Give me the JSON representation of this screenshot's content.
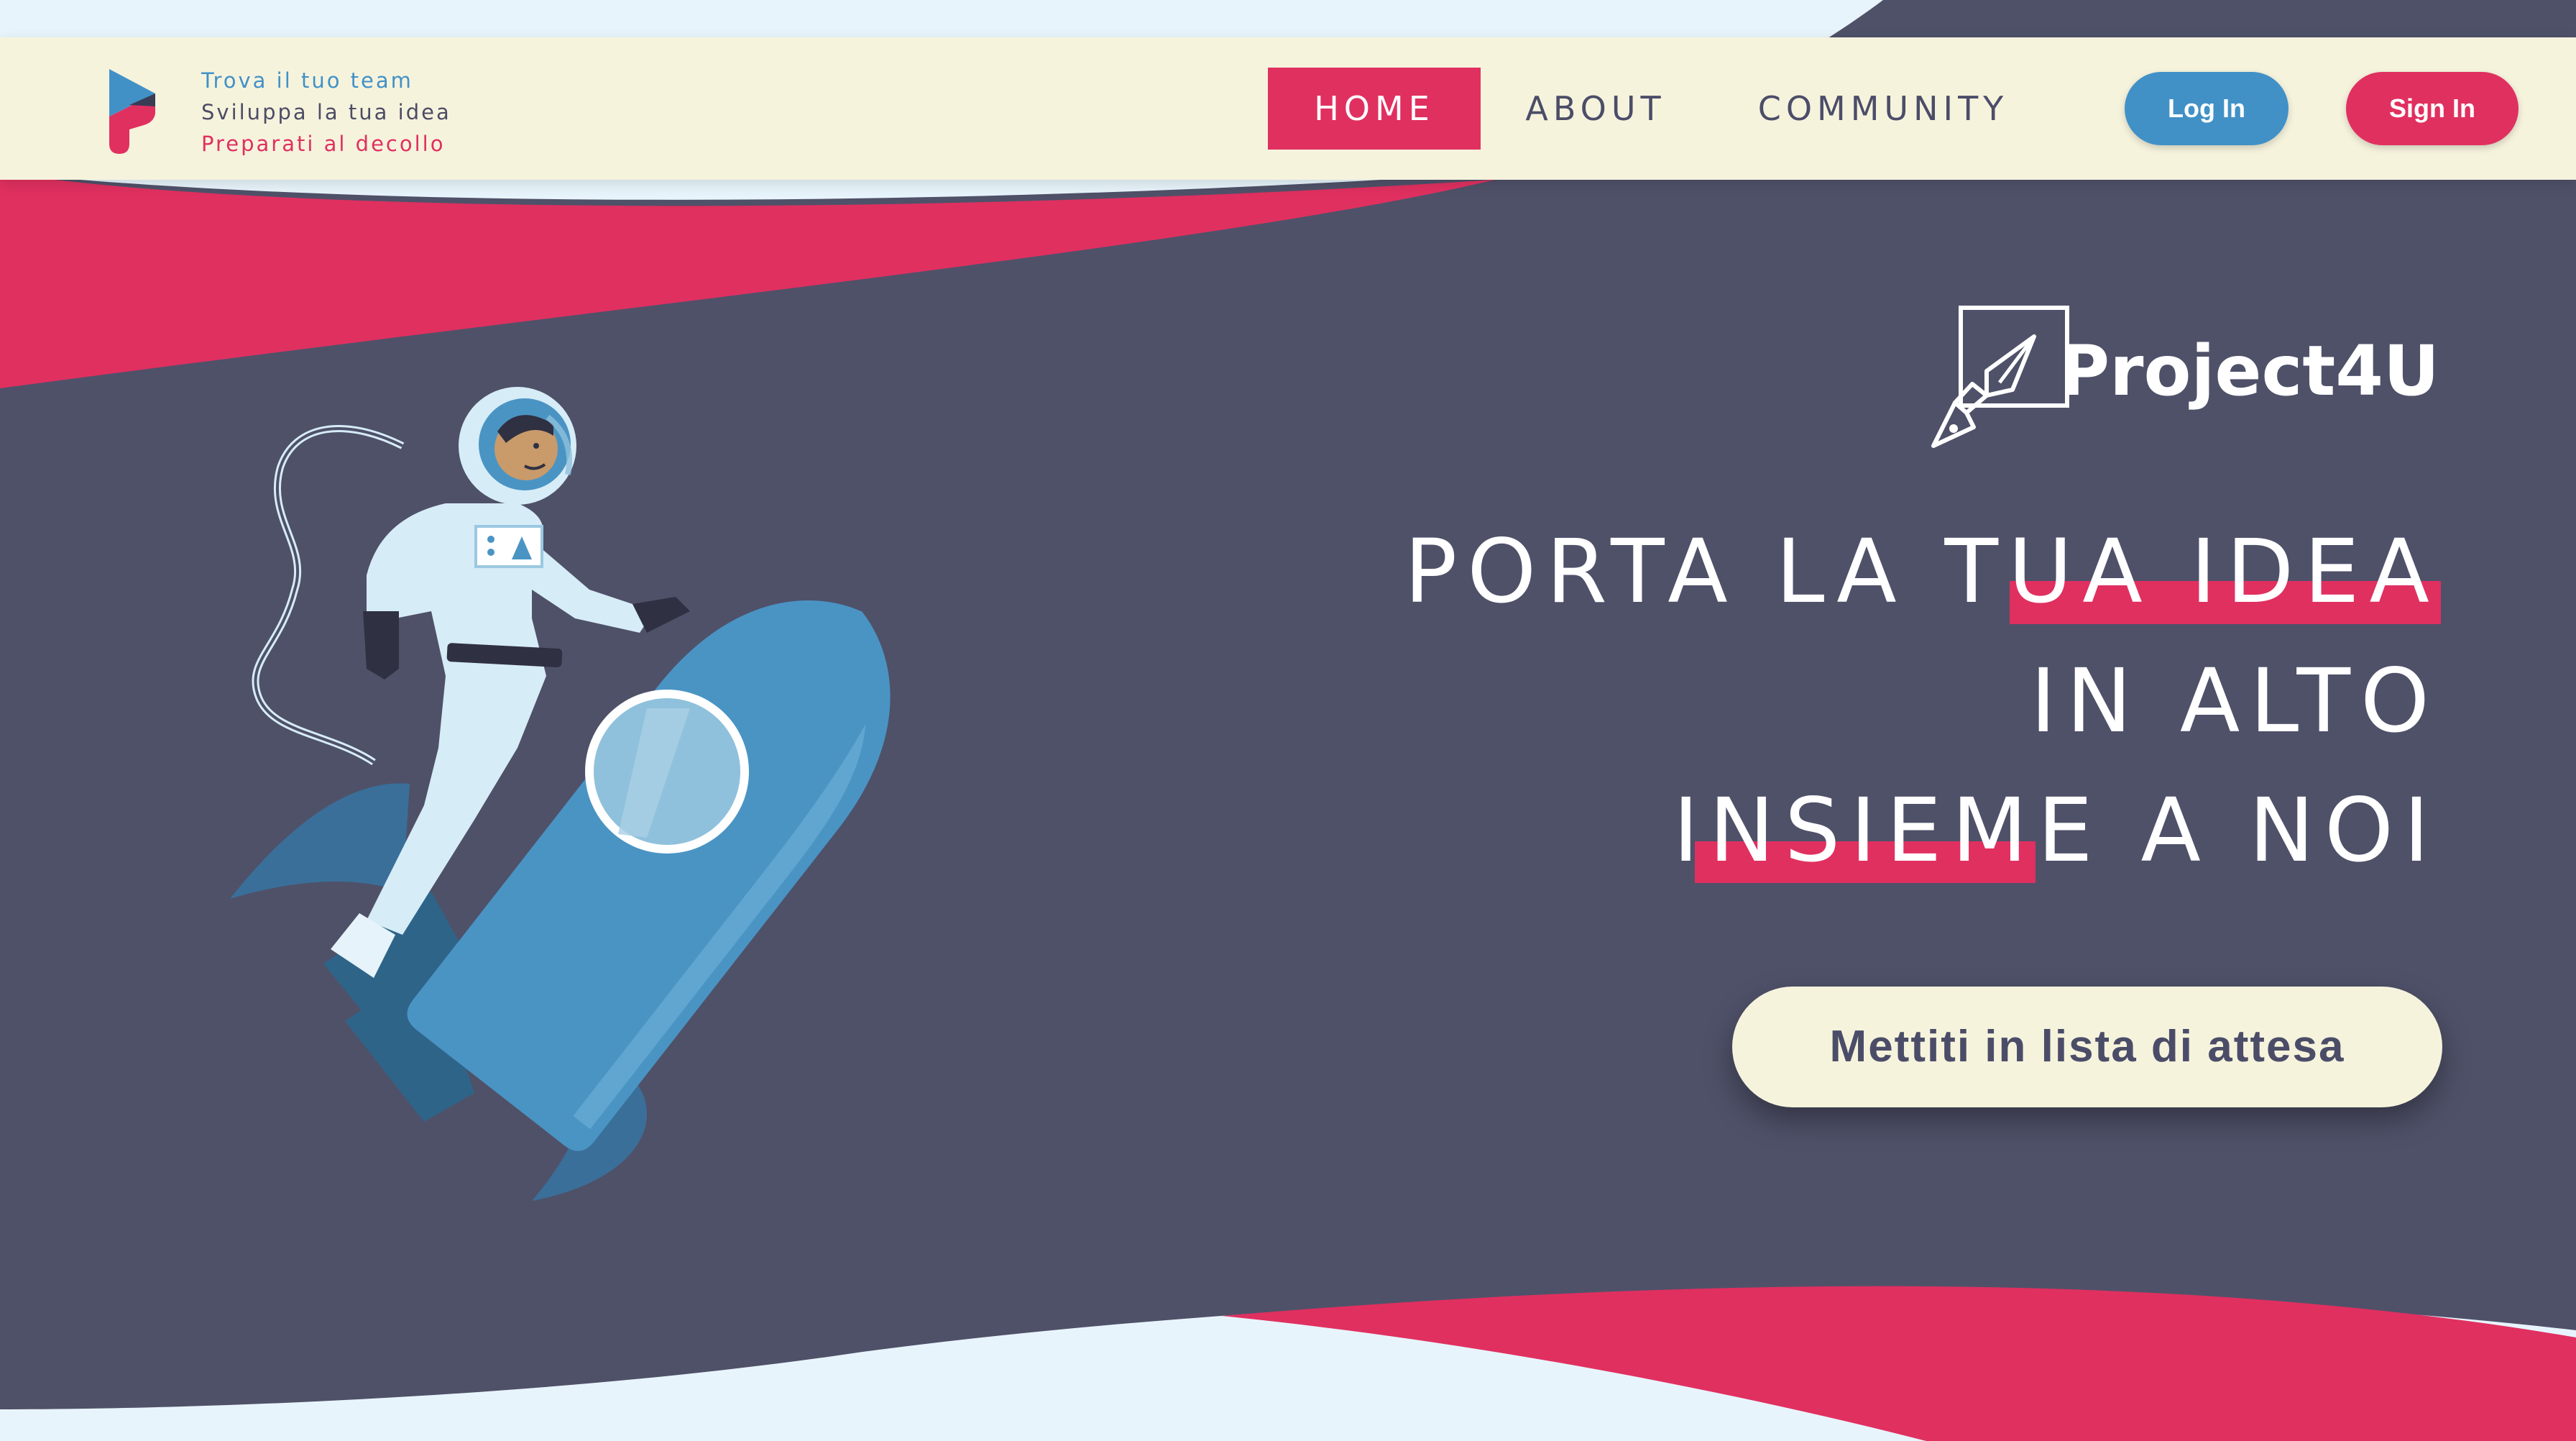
{
  "colors": {
    "accent_red": "#e03060",
    "accent_blue": "#4191c7",
    "hero_background": "#4f5169",
    "navbar_background": "#f6f3dd",
    "page_background": "#e8f4fb",
    "nav_text": "#4b4d68"
  },
  "header": {
    "logo_icon": "project4u-logo-icon",
    "taglines": [
      "Trova il tuo team",
      "Sviluppa la tua idea",
      "Preparati al decollo"
    ],
    "nav": [
      {
        "label": "HOME",
        "active": true
      },
      {
        "label": "ABOUT",
        "active": false
      },
      {
        "label": "COMMUNITY",
        "active": false
      }
    ],
    "login_label": "Log In",
    "signup_label": "Sign In"
  },
  "hero": {
    "brand_icon": "pen-nib-square-icon",
    "brand_name": "Project4U",
    "headline": [
      "PORTA LA TUA IDEA",
      "IN ALTO",
      "INSIEME A NOI"
    ],
    "cta_label": "Mettiti in lista di attesa",
    "illustration": "astronaut-riding-rocket"
  }
}
